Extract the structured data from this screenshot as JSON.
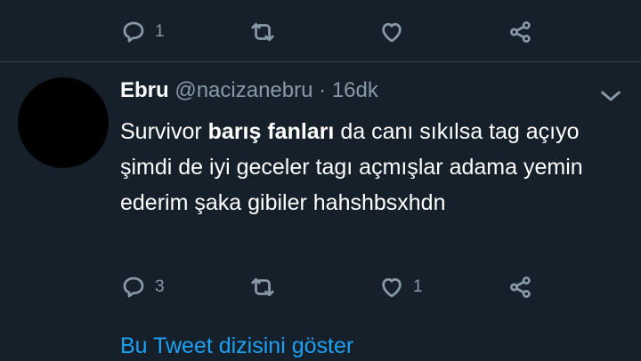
{
  "top_actions": {
    "reply_count": "1",
    "retweet_count": "",
    "like_count": ""
  },
  "tweet": {
    "name": "Ebru",
    "handle": "@nacizanebru",
    "separator": "·",
    "time": "16dk",
    "text_part1": "Survivor ",
    "text_bold": "barış fanları",
    "text_part2": " da canı sıkılsa tag açıyo şimdi de iyi geceler tagı açmışlar adama yemin ederim şaka gibiler hahshbsxhdn",
    "reply_count": "3",
    "retweet_count": "",
    "like_count": "1"
  },
  "thread_link": "Bu Tweet dizisini göster",
  "icons": [
    "reply-icon",
    "retweet-icon",
    "like-icon",
    "share-icon",
    "chevron-down-icon"
  ],
  "colors": {
    "background": "#15202b",
    "muted": "#8899a6",
    "link": "#1da1f2",
    "divider": "#38444d"
  }
}
